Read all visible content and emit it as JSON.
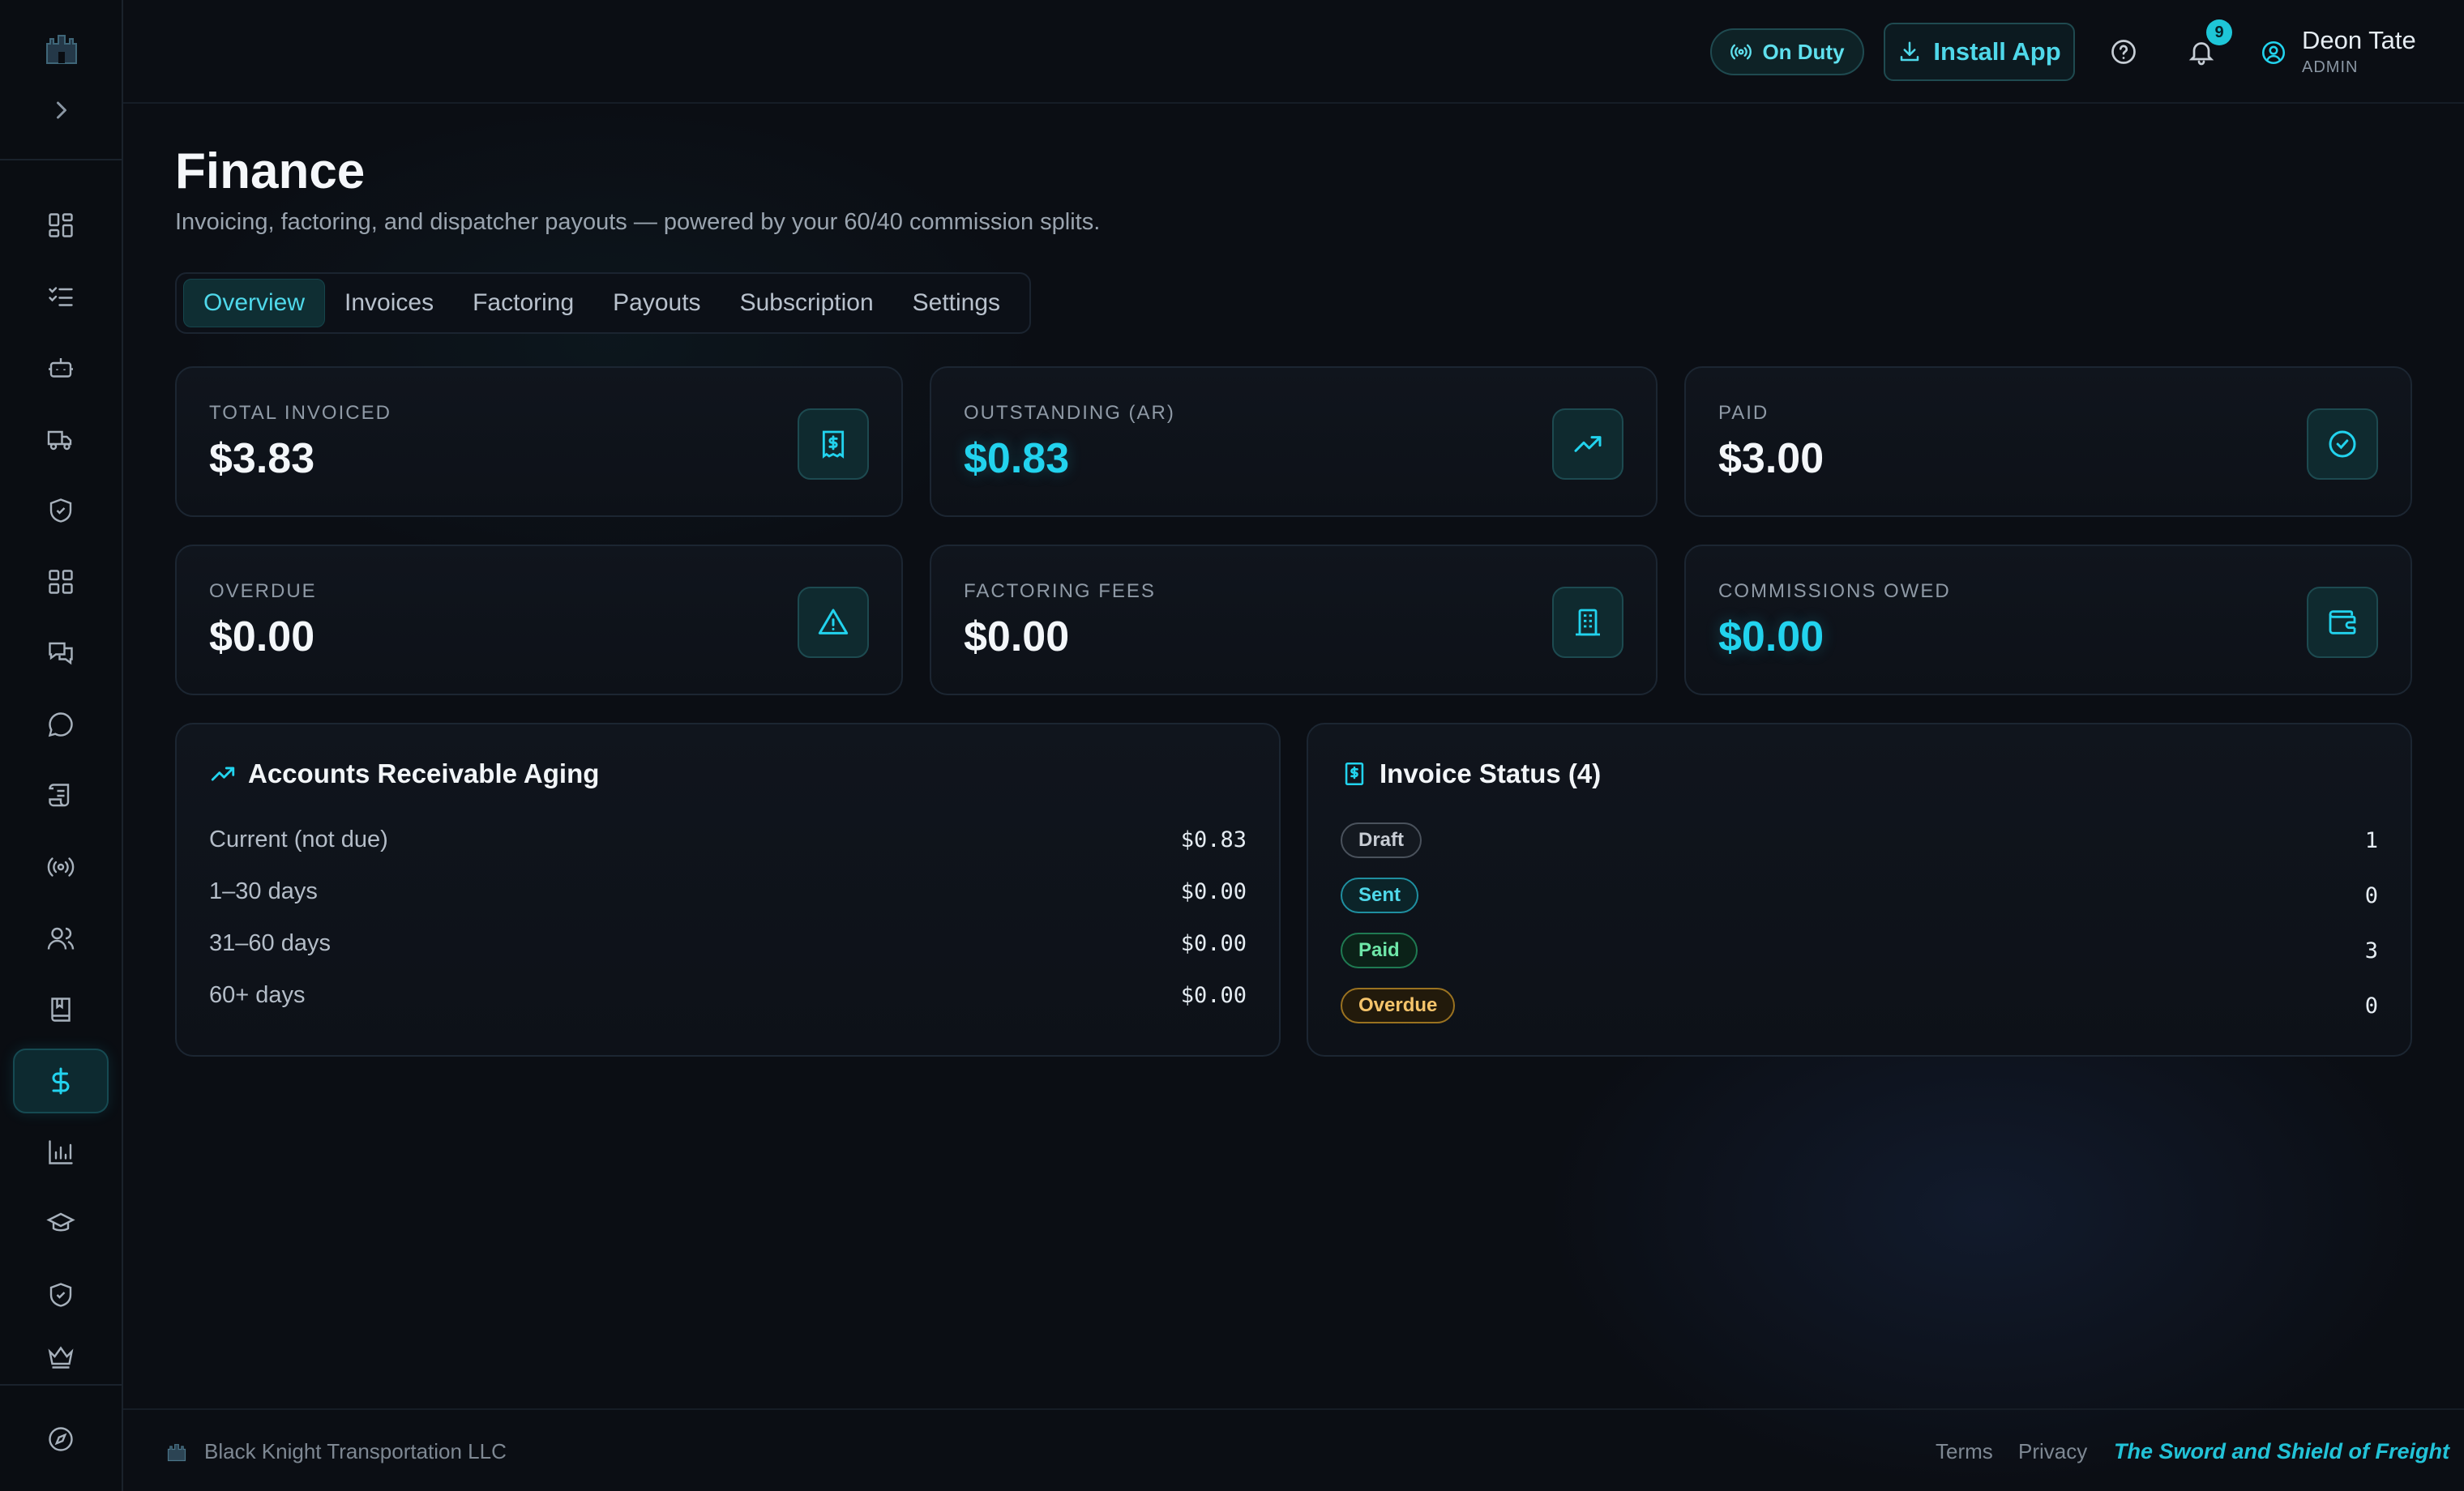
{
  "header": {
    "duty_label": "On Duty",
    "install_label": "Install App",
    "notification_count": "9",
    "user_name": "Deon Tate",
    "user_role": "ADMIN"
  },
  "page": {
    "title": "Finance",
    "subtitle": "Invoicing, factoring, and dispatcher payouts — powered by your 60/40 commission splits."
  },
  "tabs": [
    {
      "label": "Overview",
      "active": true
    },
    {
      "label": "Invoices"
    },
    {
      "label": "Factoring"
    },
    {
      "label": "Payouts"
    },
    {
      "label": "Subscription"
    },
    {
      "label": "Settings"
    }
  ],
  "stats": [
    {
      "label": "TOTAL INVOICED",
      "value": "$3.83",
      "icon": "receipt-dollar-icon"
    },
    {
      "label": "OUTSTANDING (AR)",
      "value": "$0.83",
      "icon": "trending-up-icon",
      "highlight": "#22d3ee"
    },
    {
      "label": "PAID",
      "value": "$3.00",
      "icon": "check-circle-icon"
    },
    {
      "label": "OVERDUE",
      "value": "$0.00",
      "icon": "alert-triangle-icon"
    },
    {
      "label": "FACTORING FEES",
      "value": "$0.00",
      "icon": "building-icon"
    },
    {
      "label": "COMMISSIONS OWED",
      "value": "$0.00",
      "icon": "wallet-icon",
      "highlight": "#22d3ee"
    }
  ],
  "aging": {
    "title": "Accounts Receivable Aging",
    "rows": [
      {
        "label": "Current (not due)",
        "value": "$0.83"
      },
      {
        "label": "1–30 days",
        "value": "$0.00"
      },
      {
        "label": "31–60 days",
        "value": "$0.00"
      },
      {
        "label": "60+ days",
        "value": "$0.00"
      }
    ]
  },
  "invoice_status": {
    "title": "Invoice Status (4)",
    "rows": [
      {
        "label": "Draft",
        "count": "1"
      },
      {
        "label": "Sent",
        "count": "0"
      },
      {
        "label": "Paid",
        "count": "3"
      },
      {
        "label": "Overdue",
        "count": "0"
      }
    ]
  },
  "sidebar": {
    "icons": [
      "dashboard-icon",
      "checklist-icon",
      "bot-icon",
      "truck-icon",
      "shield-check-icon",
      "apps-grid-icon",
      "messages-icon",
      "chat-bubble-icon",
      "scroll-icon",
      "broadcast-icon",
      "users-icon",
      "book-icon",
      "dollar-icon",
      "bar-chart-icon",
      "graduation-cap-icon",
      "shield-icon",
      "crown-icon"
    ],
    "active": "dollar-icon",
    "bottom_icon": "compass-icon"
  },
  "footer": {
    "company": "Black Knight Transportation LLC",
    "terms": "Terms",
    "privacy": "Privacy",
    "motto": "The Sword and Shield of Freight"
  },
  "colors": {
    "accent": "#22d3ee",
    "background": "#0b0e14",
    "paid": "#6ee7a8",
    "overdue": "#f5c46b"
  }
}
